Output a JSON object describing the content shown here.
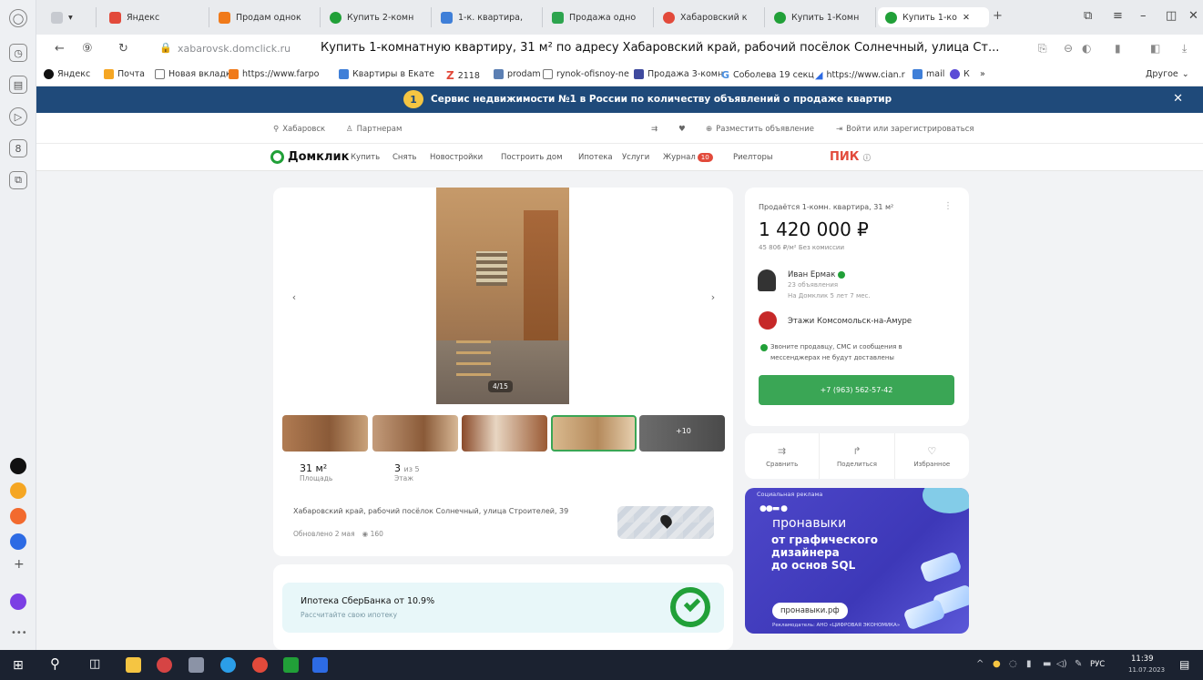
{
  "browser": {
    "tabs": [
      {
        "label": "Яндекс",
        "color": "#e24a3b"
      },
      {
        "label": "Продам однок",
        "color": "#f07a1a"
      },
      {
        "label": "Купить 2-комн",
        "color": "#21a038"
      },
      {
        "label": "1-к. квартира,",
        "color": "#3f7fd8"
      },
      {
        "label": "Продажа одно",
        "color": "#2da44e"
      },
      {
        "label": "Хабаровский к",
        "color": "#e24a3b"
      },
      {
        "label": "Купить 1-Комн",
        "color": "#21a038"
      },
      {
        "label": "Купить 1-ко",
        "color": "#21a038"
      }
    ],
    "url_domain": "xabarovsk.domclick.ru",
    "page_title": "Купить 1-комнатную квартиру, 31 м² по адресу Хабаровский край, рабочий посёлок Солнечный, улица Ст...",
    "bookmarks": [
      "Яндекс",
      "Почта",
      "Новая вкладка",
      "https://www.farpo",
      "Квартиры в Екате",
      "2118",
      "prodam",
      "rynok-ofisnoy-nedv",
      "Продажа 3-комн",
      "Соболева 19 секц",
      "https://www.cian.r",
      "mail",
      "К",
      "»"
    ],
    "bookmarks_other": "Другое"
  },
  "banner": {
    "badge": "1",
    "text": "Сервис недвижимости №1 в России по количеству объявлений о продаже квартир",
    "close": "✕"
  },
  "topline": {
    "city": "Хабаровск",
    "partners": "Партнерам",
    "post_ad": "Разместить объявление",
    "login": "Войти или зарегистрироваться"
  },
  "nav": {
    "logo": "Домклик",
    "items": [
      "Купить",
      "Снять",
      "Новостройки",
      "Построить дом",
      "Ипотека",
      "Услуги",
      "Журнал",
      "Риелторы"
    ],
    "journal_badge": "10",
    "pik": "ПИК"
  },
  "listing": {
    "photo_counter": "4/15",
    "thumb_more": "+10",
    "area_value": "31 м²",
    "area_label": "Площадь",
    "floor_value": "3",
    "floor_of": "из 5",
    "floor_label": "Этаж",
    "address": "Хабаровский край, рабочий посёлок Солнечный, улица Строителей, 39",
    "updated": "Обновлено 2 мая",
    "views": "160"
  },
  "mortgage": {
    "title": "Ипотека СберБанка от 10.9%",
    "subtitle": "Рассчитайте свою ипотеку"
  },
  "offer": {
    "title": "Продаётся 1-комн. квартира, 31 м²",
    "price": "1 420 000 ₽",
    "price_meta": "45 806 ₽/м²  Без комиссии",
    "agent_name": "Иван Ермак",
    "agent_ads": "23 объявления",
    "agent_since": "На Домклик 5 лет 7 мес.",
    "agency": "Этажи Комсомольск-на-Амуре",
    "notice": "Звоните продавцу, СМС и сообщения в мессенджерах не будут доставлены",
    "phone": "+7 (963) 562-57-42"
  },
  "actions": {
    "compare": "Сравнить",
    "share": "Поделиться",
    "favorite": "Избранное"
  },
  "ad": {
    "label": "Социальная реклама",
    "brand": "пронавыки",
    "line1": "от графического",
    "line2": "дизайнера",
    "line3": "до основ SQL",
    "site": "пронавыки.рф",
    "footer": "Рекламодатель: АНО «ЦИФРОВАЯ ЭКОНОМИКА»"
  },
  "taskbar": {
    "lang": "РУС",
    "time": "11:39",
    "date": "11.07.2023"
  }
}
